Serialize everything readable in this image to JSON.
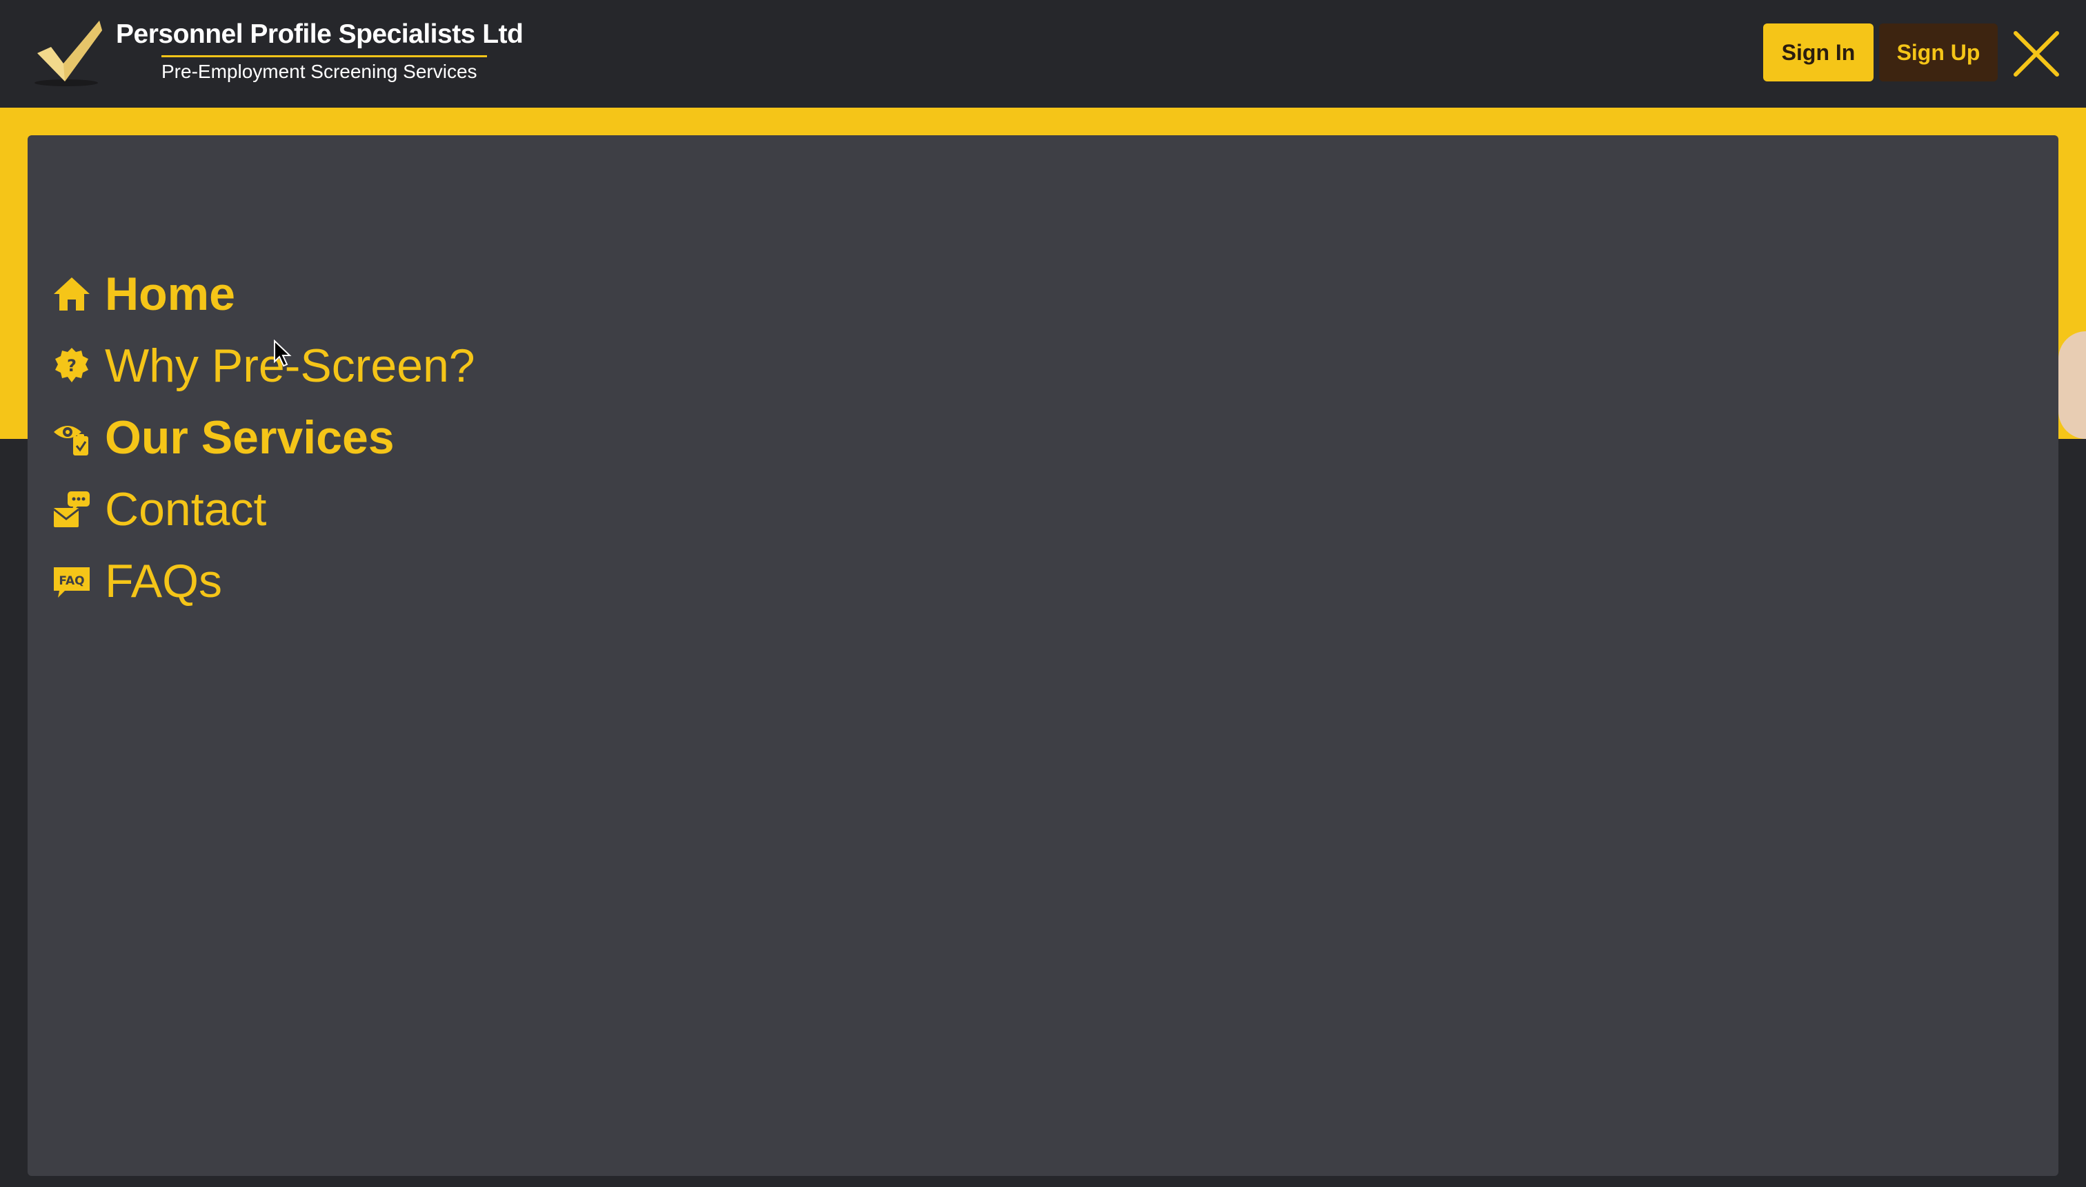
{
  "header": {
    "title": "Personnel Profile Specialists Ltd",
    "subtitle": "Pre-Employment Screening Services",
    "sign_in_label": "Sign In",
    "sign_up_label": "Sign Up",
    "logo_icon": "checkmark-logo",
    "close_icon": "close-icon"
  },
  "menu": {
    "items": [
      {
        "label": "Home",
        "icon": "home-icon",
        "bold": true
      },
      {
        "label": "Why Pre-Screen?",
        "icon": "question-badge-icon",
        "bold": false
      },
      {
        "label": "Our Services",
        "icon": "eye-clipboard-icon",
        "bold": true
      },
      {
        "label": "Contact",
        "icon": "mail-chat-icon",
        "bold": false
      },
      {
        "label": "FAQs",
        "icon": "faq-icon",
        "bold": false
      }
    ]
  },
  "colors": {
    "accent": "#f5c518",
    "background": "#26272b",
    "panel": "#3e3f45",
    "sign_up_bg": "#3d2410"
  }
}
